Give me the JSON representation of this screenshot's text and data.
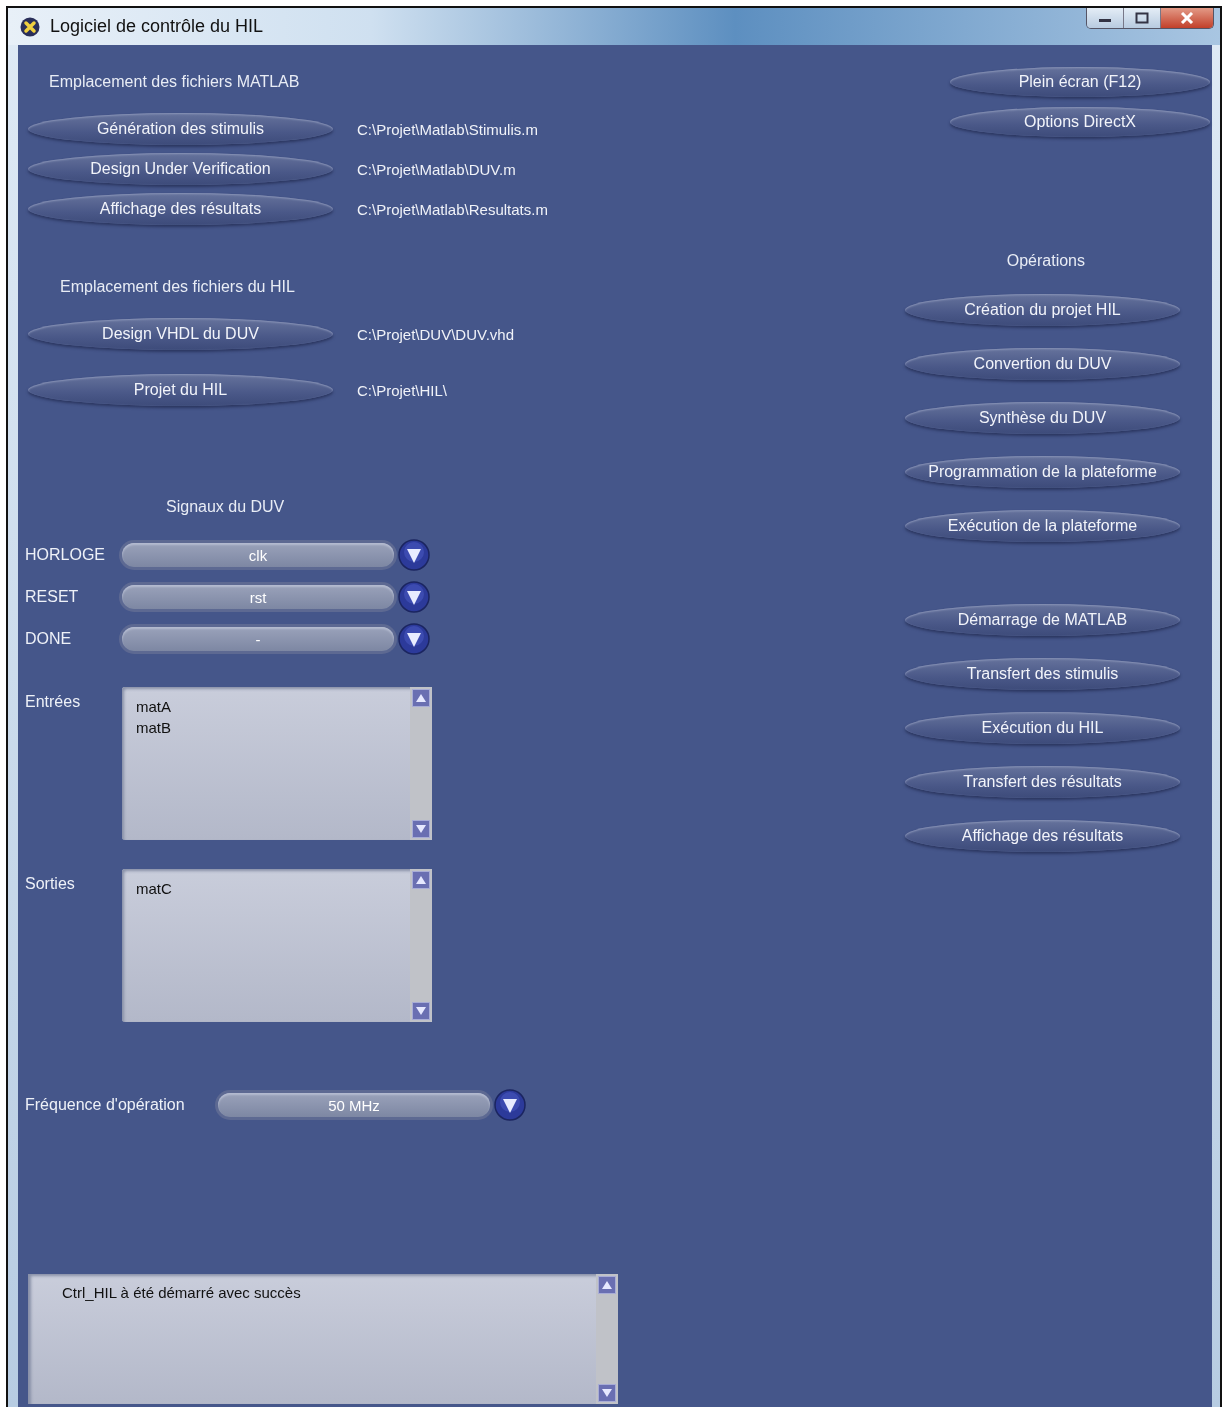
{
  "window": {
    "title": "Logiciel de contrôle du HIL"
  },
  "matlab_files": {
    "heading": "Emplacement des fichiers MATLAB",
    "rows": [
      {
        "button": "Génération des stimulis",
        "path": "C:\\Projet\\Matlab\\Stimulis.m"
      },
      {
        "button": "Design Under Verification",
        "path": "C:\\Projet\\Matlab\\DUV.m"
      },
      {
        "button": "Affichage des résultats",
        "path": "C:\\Projet\\Matlab\\Resultats.m"
      }
    ]
  },
  "hil_files": {
    "heading": "Emplacement des fichiers du HIL",
    "rows": [
      {
        "button": "Design VHDL du DUV",
        "path": "C:\\Projet\\DUV\\DUV.vhd"
      },
      {
        "button": "Projet du HIL",
        "path": "C:\\Projet\\HIL\\"
      }
    ]
  },
  "signals": {
    "heading": "Signaux du DUV",
    "selectors": [
      {
        "label": "HORLOGE",
        "value": "clk"
      },
      {
        "label": "RESET",
        "value": "rst"
      },
      {
        "label": "DONE",
        "value": "-"
      }
    ],
    "lists": [
      {
        "label": "Entrées",
        "items": [
          "matA",
          "matB"
        ]
      },
      {
        "label": "Sorties",
        "items": [
          "matC"
        ]
      }
    ]
  },
  "frequency": {
    "label": "Fréquence d'opération",
    "value": "50 MHz"
  },
  "log": {
    "lines": [
      "Ctrl_HIL à été démarré avec succès"
    ]
  },
  "display_buttons": [
    "Plein écran (F12)",
    "Options DirectX"
  ],
  "operations": {
    "heading": "Opérations",
    "groups": [
      [
        "Création du projet HIL",
        "Convertion du DUV",
        "Synthèse du DUV",
        "Programmation de la plateforme",
        "Exécution de la plateforme"
      ],
      [
        "Démarrage de MATLAB",
        "Transfert des stimulis",
        "Exécution du HIL",
        "Transfert des résultats",
        "Affichage des résultats"
      ]
    ]
  }
}
